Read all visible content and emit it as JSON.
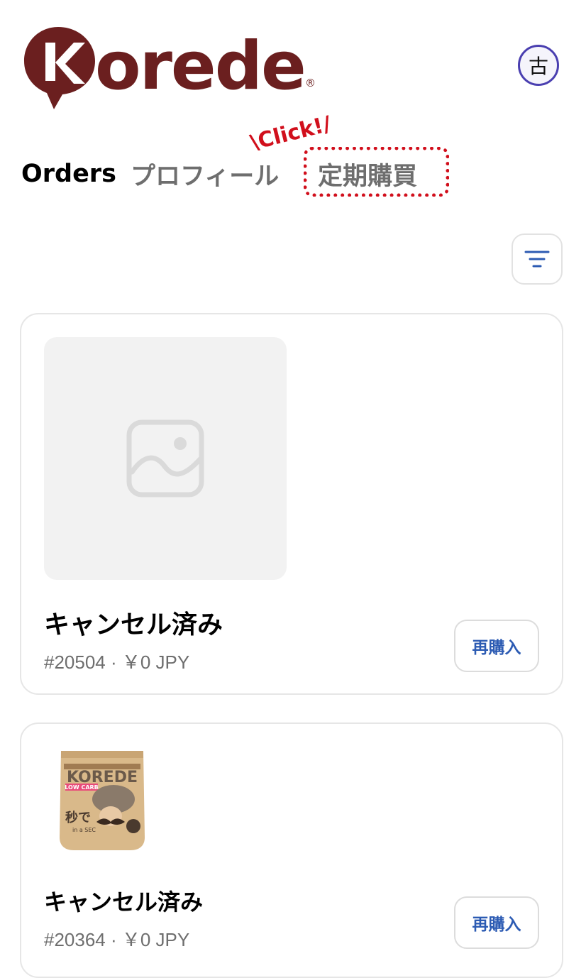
{
  "header": {
    "logo_text": "orede",
    "logo_registered": "®",
    "avatar_initial": "古"
  },
  "tabs": [
    {
      "label": "Orders",
      "active": true
    },
    {
      "label": "プロフィール",
      "active": false
    },
    {
      "label": "定期購買",
      "active": false
    }
  ],
  "annotation": {
    "text": "\\Click!/",
    "color": "#d10f1c"
  },
  "filter": {
    "icon": "filter-icon"
  },
  "orders": [
    {
      "status": "キャンセル済み",
      "meta": "#20504 · ￥0 JPY",
      "rebuy_label": "再購入",
      "thumbnail": "image-placeholder-icon"
    },
    {
      "status": "キャンセル済み",
      "meta": "#20364 · ￥0 JPY",
      "rebuy_label": "再購入",
      "thumbnail": "product-pouch-image",
      "product_package": {
        "brand": "KOREDE",
        "tag": "LOW CARB",
        "text": "秒で",
        "subtext": "in a SEC"
      }
    }
  ],
  "colors": {
    "brand": "#6b1f1f",
    "link": "#2c5bb3",
    "avatar_border": "#4a3fb0",
    "highlight": "#d10f1c"
  }
}
